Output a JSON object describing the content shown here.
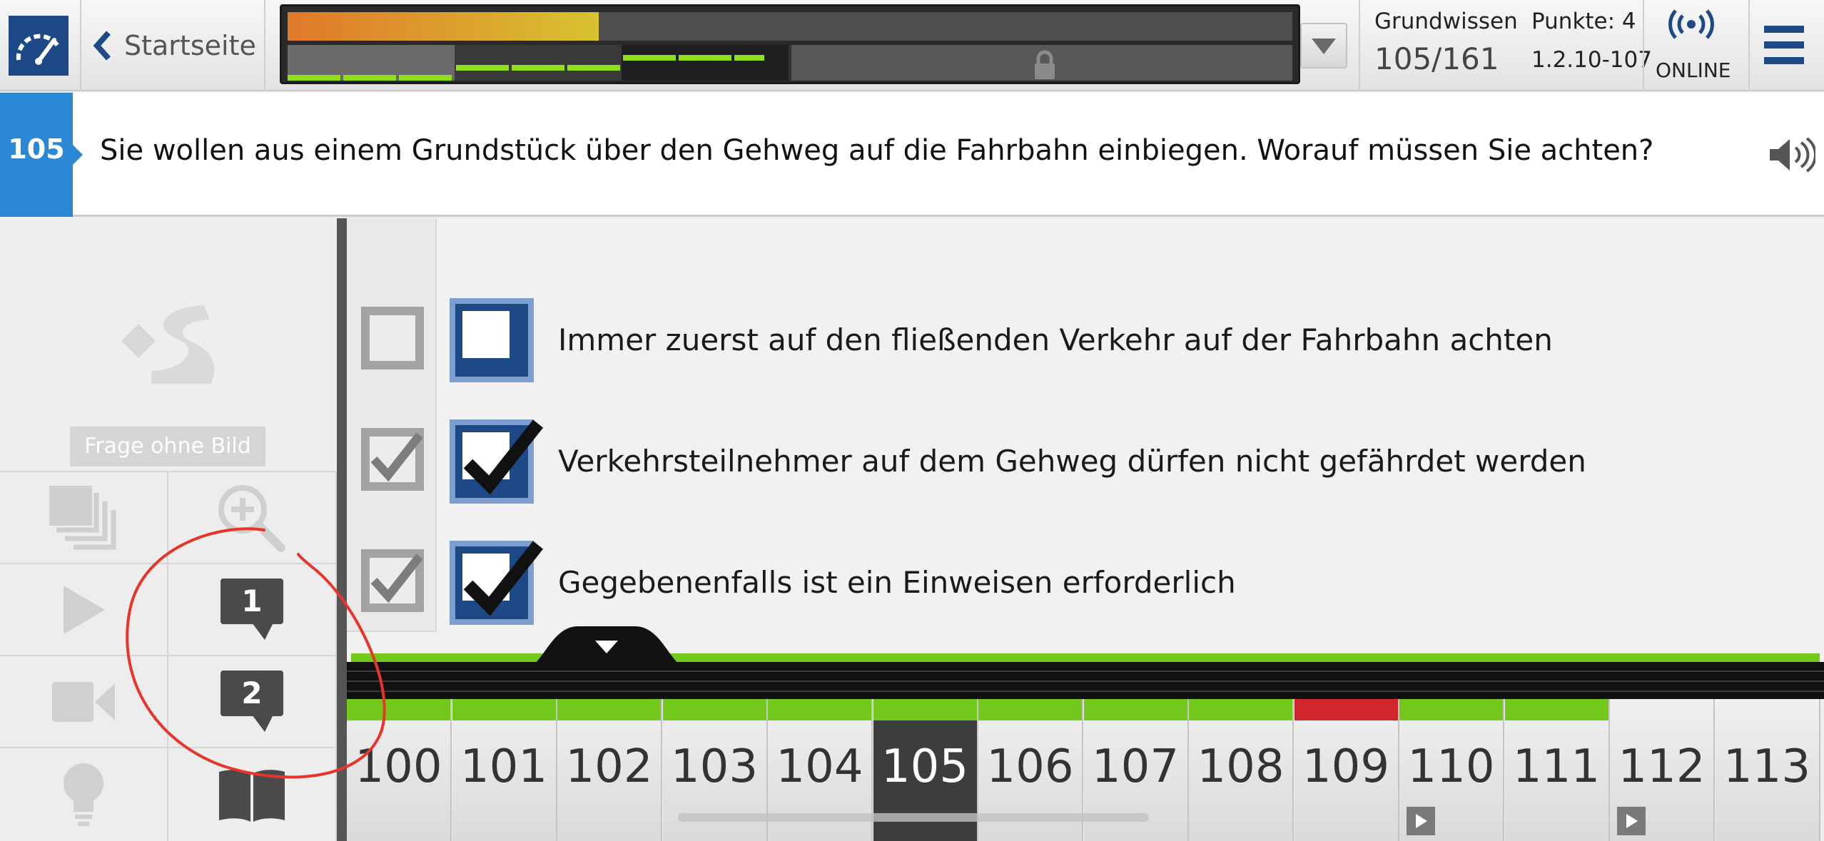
{
  "header": {
    "back_label": "Startseite",
    "category": "Grundwissen",
    "count": "105/161",
    "points": "Punkte: 4",
    "question_code": "1.2.10-107",
    "online_label": "ONLINE",
    "progress_fraction": 0.31
  },
  "question": {
    "number": "105",
    "text": "Sie wollen aus einem Grundstück über den Gehweg auf die Fahrbahn einbiegen. Worauf müssen Sie achten?"
  },
  "left_panel": {
    "no_image_label": "Frage ohne Bild",
    "bubble_1": "1",
    "bubble_2": "2"
  },
  "answers": [
    {
      "text": "Immer zuerst auf den fließenden Verkehr auf der Fahrbahn achten",
      "correct": false,
      "selected": false
    },
    {
      "text": "Verkehrsteilnehmer auf dem Gehweg dürfen nicht gefährdet werden",
      "correct": true,
      "selected": true
    },
    {
      "text": "Gegebenenfalls ist ein Einweisen erforderlich",
      "correct": true,
      "selected": true
    }
  ],
  "nav": {
    "tiles": [
      {
        "num": "100",
        "status": "correct",
        "video": false
      },
      {
        "num": "101",
        "status": "correct",
        "video": false
      },
      {
        "num": "102",
        "status": "correct",
        "video": false
      },
      {
        "num": "103",
        "status": "correct",
        "video": false
      },
      {
        "num": "104",
        "status": "correct",
        "video": false
      },
      {
        "num": "105",
        "status": "correct",
        "video": false,
        "current": true
      },
      {
        "num": "106",
        "status": "correct",
        "video": false
      },
      {
        "num": "107",
        "status": "correct",
        "video": false
      },
      {
        "num": "108",
        "status": "correct",
        "video": false
      },
      {
        "num": "109",
        "status": "wrong",
        "video": false
      },
      {
        "num": "110",
        "status": "correct",
        "video": true
      },
      {
        "num": "111",
        "status": "correct",
        "video": false
      },
      {
        "num": "112",
        "status": "none",
        "video": true
      },
      {
        "num": "113",
        "status": "none",
        "video": false
      }
    ]
  },
  "colors": {
    "brand_blue": "#1d4a86",
    "accent_blue": "#2a88d5",
    "correct_green": "#73c91b",
    "wrong_red": "#d0262b",
    "annotation_red": "#e8352b"
  }
}
